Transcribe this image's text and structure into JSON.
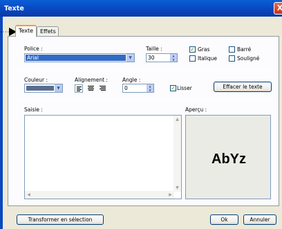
{
  "window": {
    "title": "Texte",
    "close_glyph": "X"
  },
  "tabs": [
    {
      "label": "Texte"
    },
    {
      "label": "Effets"
    }
  ],
  "font": {
    "label": "Police :",
    "value": "Arial"
  },
  "size": {
    "label": "Taille :",
    "value": "30"
  },
  "styles": {
    "bold": {
      "label": "Gras",
      "checked": true
    },
    "italic": {
      "label": "Italique",
      "checked": false
    },
    "strike": {
      "label": "Barré",
      "checked": false
    },
    "underline": {
      "label": "Souligné",
      "checked": false
    }
  },
  "color": {
    "label": "Couleur :",
    "swatch": "#5a6d90"
  },
  "alignment": {
    "label": "Alignement :",
    "options": [
      "left",
      "center",
      "right"
    ],
    "selected": "left"
  },
  "angle": {
    "label": "Angle :",
    "value": "0"
  },
  "smooth": {
    "label": "Lisser",
    "checked": true
  },
  "clear_button": {
    "label": "Effacer le texte"
  },
  "input": {
    "label": "Saisie :",
    "value": ""
  },
  "preview": {
    "label": "Aperçu :",
    "text": "AbYz"
  },
  "footer": {
    "transform_label": "Transformer en sélection",
    "ok_label": "Ok",
    "cancel_label": "Annuler"
  },
  "check_glyph": "✓",
  "pointer": {
    "dots": "·····"
  }
}
